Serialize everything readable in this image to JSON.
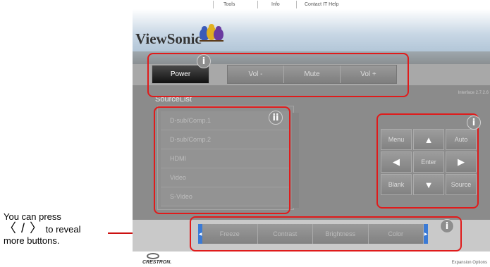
{
  "instruction": {
    "line1": "You can press",
    "arrows": "〈 / 〉",
    "line2": "to reveal",
    "line3": "more buttons."
  },
  "topbar": {
    "links": [
      "Tools",
      "Info",
      "Contact IT Help"
    ]
  },
  "brand": {
    "logo": "ViewSonic"
  },
  "controls": {
    "power": "Power",
    "volume": [
      "Vol -",
      "Mute",
      "Vol +"
    ]
  },
  "interface_version": "Interface 2.7.2.6",
  "source": {
    "title": "SourceList",
    "items": [
      "D-sub/Comp.1",
      "D-sub/Comp.2",
      "HDMI",
      "Video",
      "S-Video"
    ]
  },
  "nav": {
    "menu": "Menu",
    "up": "▲",
    "auto": "Auto",
    "left": "◀",
    "enter": "Enter",
    "right": "▶",
    "blank": "Blank",
    "down": "▼",
    "source": "Source"
  },
  "expansion_buttons": [
    "Freeze",
    "Contrast",
    "Brightness",
    "Color"
  ],
  "footer": {
    "crestron": "CRESTRON.",
    "expansion": "Expansion Options"
  },
  "callouts": {
    "i": "i",
    "ii": "ii"
  },
  "colors": {
    "annotation": "#e01b1b",
    "panel": "#8b8b8b",
    "carousel_arrow": "#3a7ad6"
  }
}
